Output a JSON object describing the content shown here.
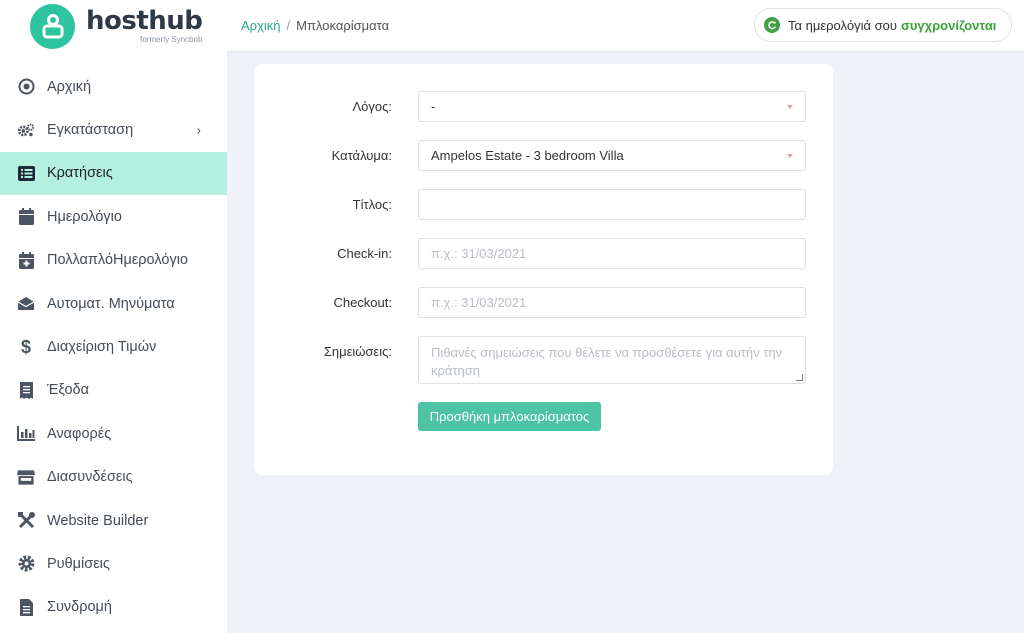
{
  "brand": {
    "name": "hosthub",
    "subtitle": "formerly Syncbnb"
  },
  "colors": {
    "accent": "#2ec4a0",
    "active_bg": "#b3f0df",
    "button": "#4cc4a5",
    "sync_green": "#3aa33a"
  },
  "sidebar": {
    "items": [
      {
        "label": "Αρχική",
        "icon": "target-icon"
      },
      {
        "label": "Εγκατάσταση",
        "icon": "gears-icon",
        "has_submenu": true
      },
      {
        "label": "Κρατήσεις",
        "icon": "list-icon",
        "active": true
      },
      {
        "label": "Ημερολόγιο",
        "icon": "calendar-icon"
      },
      {
        "label": "ΠολλαπλόΗμερολόγιο",
        "icon": "calendar-plus-icon"
      },
      {
        "label": "Αυτοματ. Μηνύματα",
        "icon": "envelope-icon"
      },
      {
        "label": "Διαχείριση Τιμών",
        "icon": "dollar-icon"
      },
      {
        "label": "Έξοδα",
        "icon": "receipt-icon"
      },
      {
        "label": "Αναφορές",
        "icon": "bar-chart-icon"
      },
      {
        "label": "Διασυνδέσεις",
        "icon": "store-icon"
      },
      {
        "label": "Website Builder",
        "icon": "tools-icon"
      },
      {
        "label": "Ρυθμίσεις",
        "icon": "cog-icon"
      },
      {
        "label": "Συνδρομή",
        "icon": "file-icon"
      }
    ]
  },
  "breadcrumb": {
    "home": "Αρχική",
    "separator": "/",
    "current": "Μπλοκαρίσματα"
  },
  "sync": {
    "text": "Τα ημερολόγιά σου",
    "strong": "συγχρονίζονται",
    "icon": "refresh-icon"
  },
  "form": {
    "reason": {
      "label": "Λόγος:",
      "value": "-"
    },
    "property": {
      "label": "Κατάλυμα:",
      "value": "Ampelos Estate - 3 bedroom Villa"
    },
    "title": {
      "label": "Τίτλος:",
      "value": ""
    },
    "checkin": {
      "label": "Check-in:",
      "placeholder": "π.χ.: 31/03/2021"
    },
    "checkout": {
      "label": "Checkout:",
      "placeholder": "π.χ.: 31/03/2021"
    },
    "notes": {
      "label": "Σημειώσεις:",
      "placeholder": "Πιθανές σημειώσεις που θέλετε να προσθέσετε για αυτήν την κράτηση"
    },
    "submit_label": "Προσθήκη μπλοκαρίσματος"
  }
}
